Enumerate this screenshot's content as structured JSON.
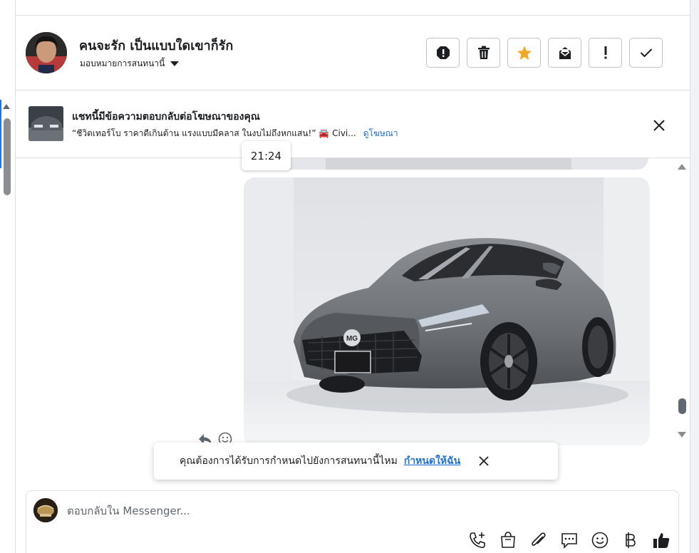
{
  "header": {
    "contact_name": "คนจะรัก เป็นแบบใดเขาก็รัก",
    "assign_label": "มอบหมายการสนทนานี้",
    "toolbar": [
      "alert-icon",
      "trash-icon",
      "star-icon",
      "mark-unread-icon",
      "exclamation-icon",
      "check-icon"
    ],
    "accent_star": "#f5a623"
  },
  "ad": {
    "title": "แชทนี้มีข้อความตอบกลับต่อโฆษณาของคุณ",
    "quote": "“ชีวิตเทอร์โบ ราคาดีเกินต้าน แรงแบบมีคลาส ในงบไม่ถึงหกแสน!” 🚘 Civi...",
    "link": "ดูโฆษณา"
  },
  "chat": {
    "timestamp": "21:24"
  },
  "prompt": {
    "text": "คุณต้องการได้รับการกำหนดไปยังการสนทนานี้ไหม",
    "link": "กำหนดให้ฉัน"
  },
  "composer": {
    "placeholder": "ตอบกลับใน Messenger...",
    "icons": [
      "call-add-icon",
      "shopping-bag-icon",
      "attachment-icon",
      "saved-reply-icon",
      "emoji-icon",
      "baht-icon",
      "thumbs-up-icon"
    ]
  },
  "colors": {
    "link": "#216fdb",
    "border": "#dddfe2"
  }
}
